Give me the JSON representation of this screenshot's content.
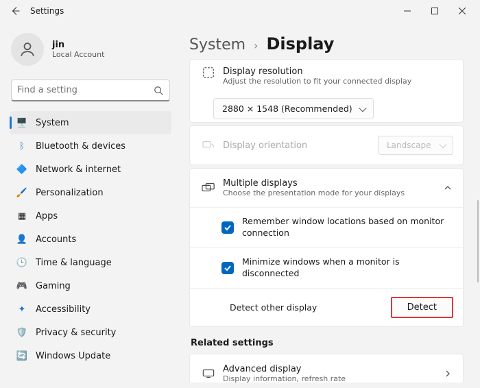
{
  "titlebar": {
    "title": "Settings"
  },
  "profile": {
    "name": "jin",
    "type": "Local Account"
  },
  "search": {
    "placeholder": "Find a setting"
  },
  "nav": {
    "items": [
      {
        "label": "System"
      },
      {
        "label": "Bluetooth & devices"
      },
      {
        "label": "Network & internet"
      },
      {
        "label": "Personalization"
      },
      {
        "label": "Apps"
      },
      {
        "label": "Accounts"
      },
      {
        "label": "Time & language"
      },
      {
        "label": "Gaming"
      },
      {
        "label": "Accessibility"
      },
      {
        "label": "Privacy & security"
      },
      {
        "label": "Windows Update"
      }
    ]
  },
  "breadcrumb": {
    "parent": "System",
    "current": "Display"
  },
  "resolution": {
    "title": "Display resolution",
    "sub": "Adjust the resolution to fit your connected display",
    "value": "2880 × 1548 (Recommended)"
  },
  "orientation": {
    "title": "Display orientation",
    "value": "Landscape"
  },
  "multi": {
    "title": "Multiple displays",
    "sub": "Choose the presentation mode for your displays",
    "check1": "Remember window locations based on monitor connection",
    "check2": "Minimize windows when a monitor is disconnected",
    "detect_label": "Detect other display",
    "detect_btn": "Detect"
  },
  "related": {
    "heading": "Related settings"
  },
  "advanced": {
    "title": "Advanced display",
    "sub": "Display information, refresh rate"
  }
}
